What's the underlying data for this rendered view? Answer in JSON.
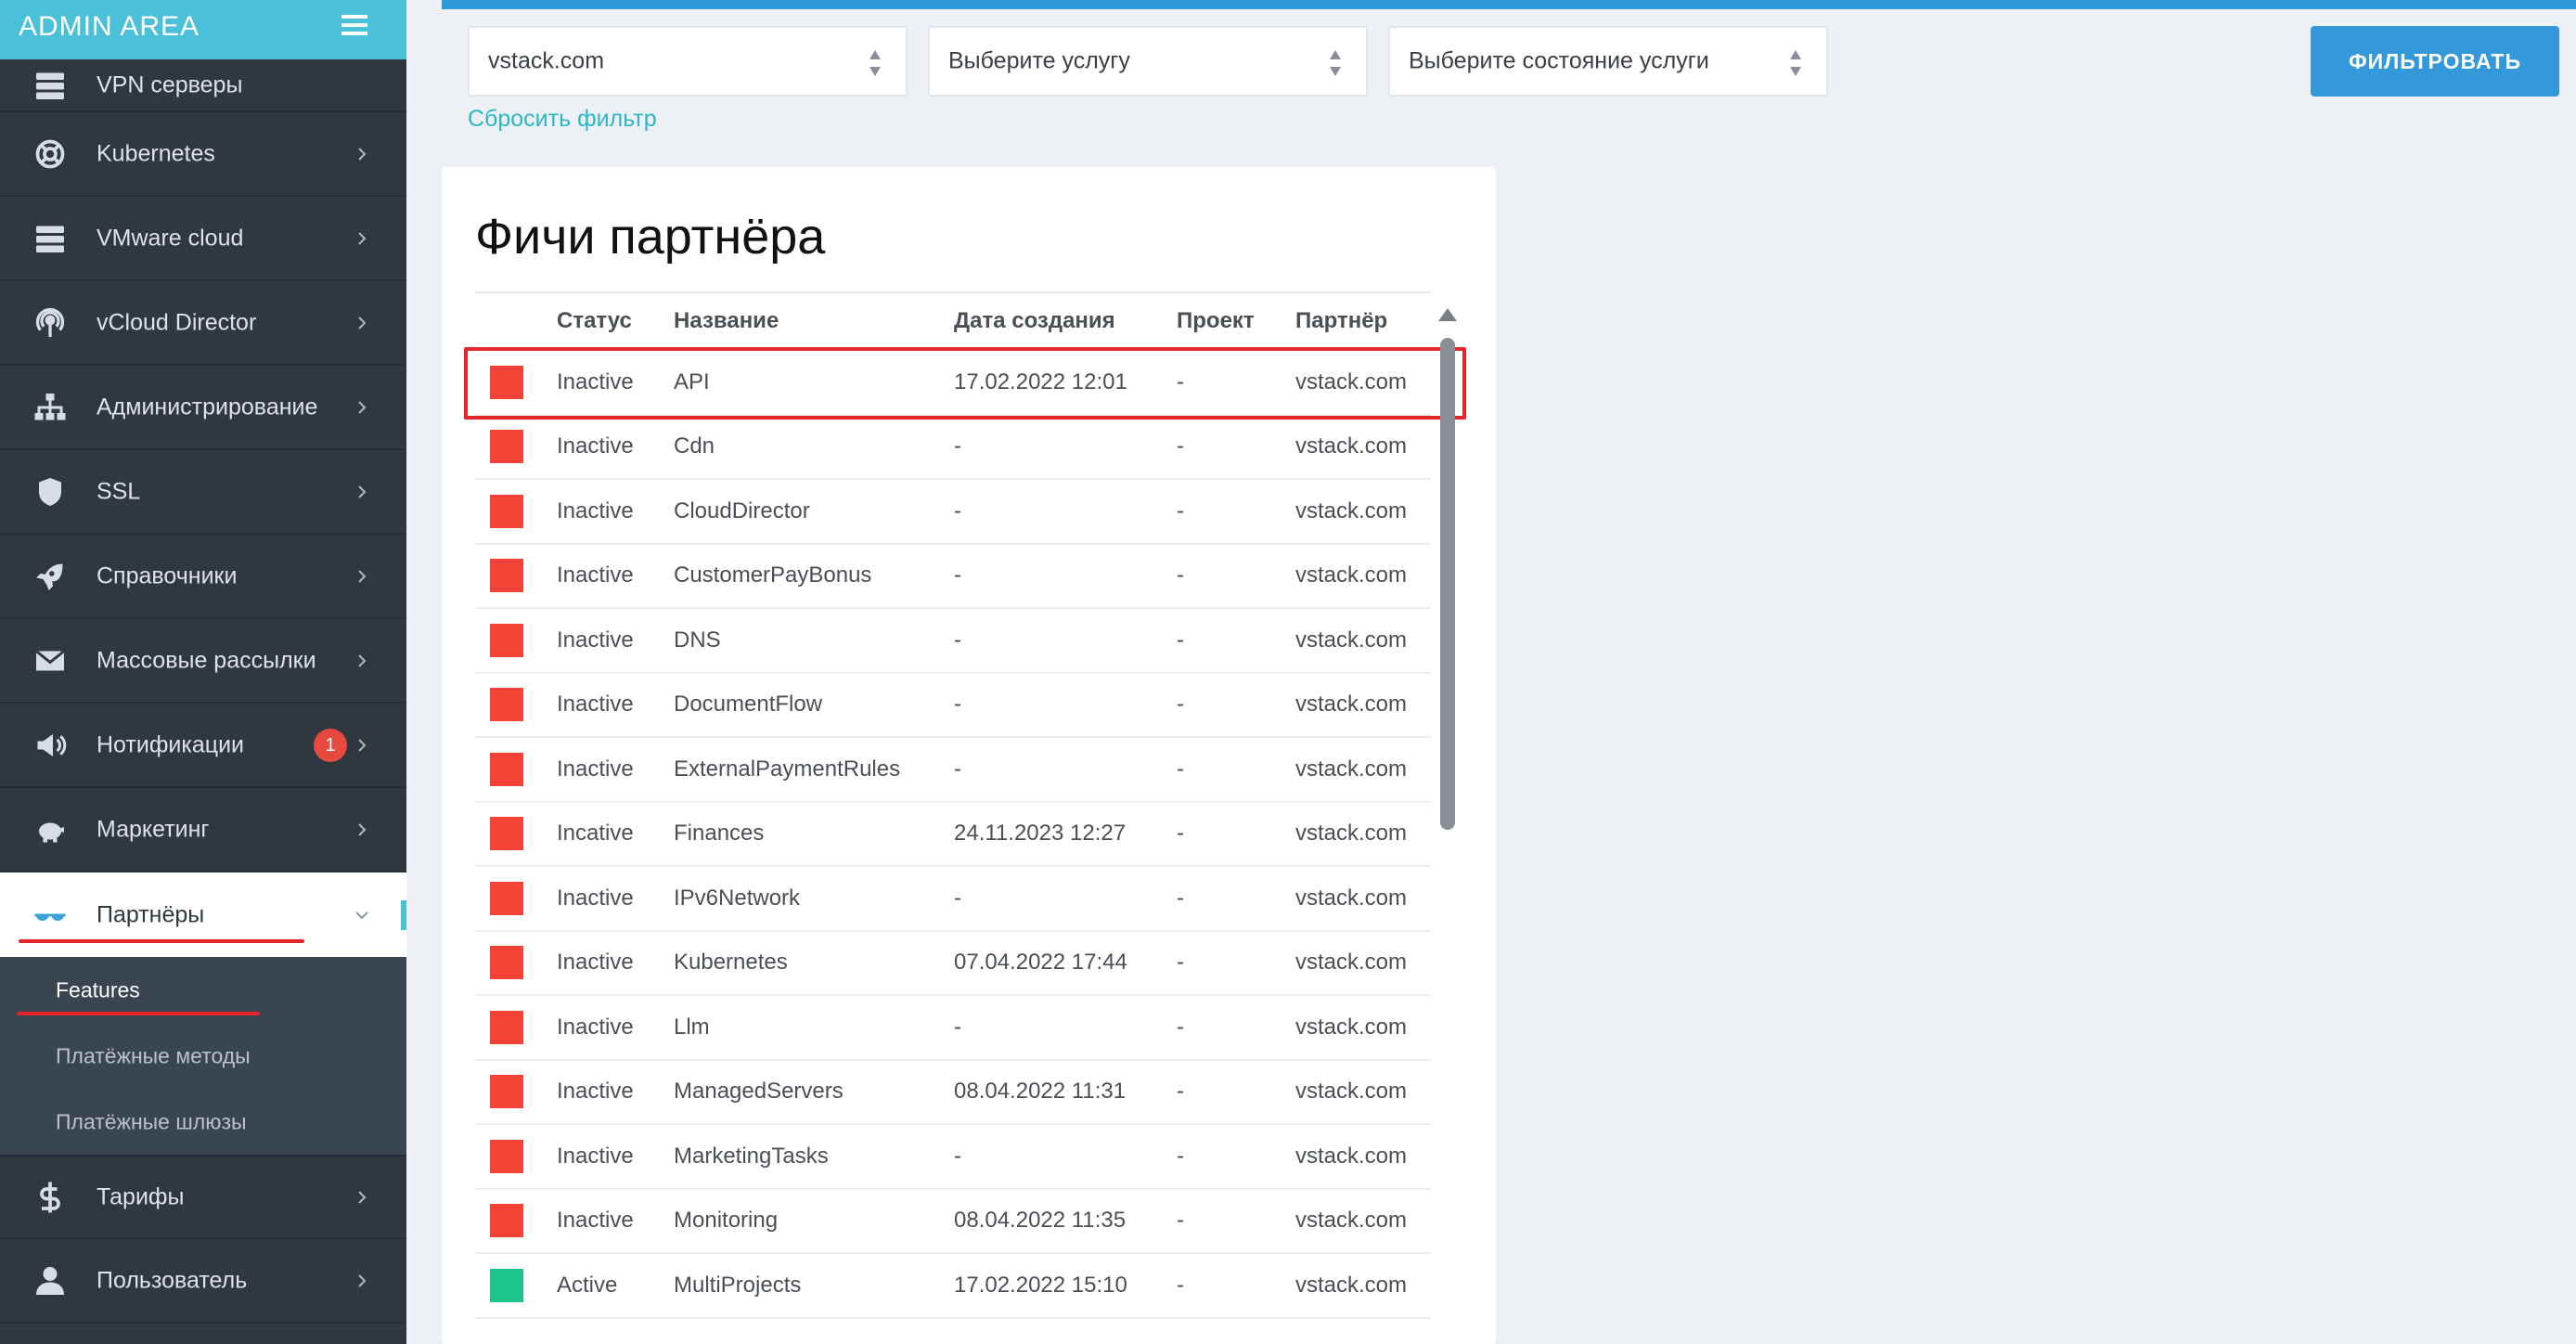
{
  "sidebar": {
    "brand": "ADMIN AREA",
    "items": [
      {
        "label": "VPN серверы",
        "icon": "server-icon"
      },
      {
        "label": "Kubernetes",
        "icon": "lifebuoy-icon"
      },
      {
        "label": "VMware cloud",
        "icon": "server-icon"
      },
      {
        "label": "vCloud Director",
        "icon": "podcast-icon"
      },
      {
        "label": "Администрирование",
        "icon": "sitemap-icon"
      },
      {
        "label": "SSL",
        "icon": "shield-icon"
      },
      {
        "label": "Справочники",
        "icon": "rocket-icon"
      },
      {
        "label": "Массовые рассылки",
        "icon": "envelope-icon"
      },
      {
        "label": "Нотификации",
        "icon": "megaphone-icon",
        "badge": "1"
      },
      {
        "label": "Маркетинг",
        "icon": "piggy-bank-icon"
      },
      {
        "label": "Партнёры",
        "icon": "glasses-icon"
      },
      {
        "label": "Тарифы",
        "icon": "dollar-icon"
      },
      {
        "label": "Пользователь",
        "icon": "user-icon"
      }
    ],
    "submenu": [
      {
        "label": "Features"
      },
      {
        "label": "Платёжные методы"
      },
      {
        "label": "Платёжные шлюзы"
      }
    ]
  },
  "filters": {
    "partner_value": "vstack.com",
    "service_placeholder": "Выберите услугу",
    "state_placeholder": "Выберите состояние услуги",
    "reset_label": "Сбросить фильтр",
    "filter_button": "ФИЛЬТРОВАТЬ"
  },
  "card": {
    "title": "Фичи партнёра",
    "columns": {
      "status": "Статус",
      "name": "Название",
      "date": "Дата создания",
      "project": "Проект",
      "partner": "Партнёр"
    },
    "rows": [
      {
        "status": "Inactive",
        "name": "API",
        "date": "17.02.2022 12:01",
        "project": "-",
        "partner": "vstack.com",
        "color": "#f44336"
      },
      {
        "status": "Inactive",
        "name": "Cdn",
        "date": "-",
        "project": "-",
        "partner": "vstack.com",
        "color": "#f44336"
      },
      {
        "status": "Inactive",
        "name": "CloudDirector",
        "date": "-",
        "project": "-",
        "partner": "vstack.com",
        "color": "#f44336"
      },
      {
        "status": "Inactive",
        "name": "CustomerPayBonus",
        "date": "-",
        "project": "-",
        "partner": "vstack.com",
        "color": "#f44336"
      },
      {
        "status": "Inactive",
        "name": "DNS",
        "date": "-",
        "project": "-",
        "partner": "vstack.com",
        "color": "#f44336"
      },
      {
        "status": "Inactive",
        "name": "DocumentFlow",
        "date": "-",
        "project": "-",
        "partner": "vstack.com",
        "color": "#f44336"
      },
      {
        "status": "Inactive",
        "name": "ExternalPaymentRules",
        "date": "-",
        "project": "-",
        "partner": "vstack.com",
        "color": "#f44336"
      },
      {
        "status": "Incative",
        "name": "Finances",
        "date": "24.11.2023 12:27",
        "project": "-",
        "partner": "vstack.com",
        "color": "#f44336"
      },
      {
        "status": "Inactive",
        "name": "IPv6Network",
        "date": "-",
        "project": "-",
        "partner": "vstack.com",
        "color": "#f44336"
      },
      {
        "status": "Inactive",
        "name": "Kubernetes",
        "date": "07.04.2022 17:44",
        "project": "-",
        "partner": "vstack.com",
        "color": "#f44336"
      },
      {
        "status": "Inactive",
        "name": "Llm",
        "date": "-",
        "project": "-",
        "partner": "vstack.com",
        "color": "#f44336"
      },
      {
        "status": "Inactive",
        "name": "ManagedServers",
        "date": "08.04.2022 11:31",
        "project": "-",
        "partner": "vstack.com",
        "color": "#f44336"
      },
      {
        "status": "Inactive",
        "name": "MarketingTasks",
        "date": "-",
        "project": "-",
        "partner": "vstack.com",
        "color": "#f44336"
      },
      {
        "status": "Inactive",
        "name": "Monitoring",
        "date": "08.04.2022 11:35",
        "project": "-",
        "partner": "vstack.com",
        "color": "#f44336"
      },
      {
        "status": "Active",
        "name": "MultiProjects",
        "date": "17.02.2022 15:10",
        "project": "-",
        "partner": "vstack.com",
        "color": "#1ec28b"
      }
    ]
  },
  "colors": {
    "accent": "#4bc0d9",
    "primary": "#3399db",
    "inactive": "#f44336",
    "active": "#1ec28b",
    "annotation": "#e3262c"
  }
}
